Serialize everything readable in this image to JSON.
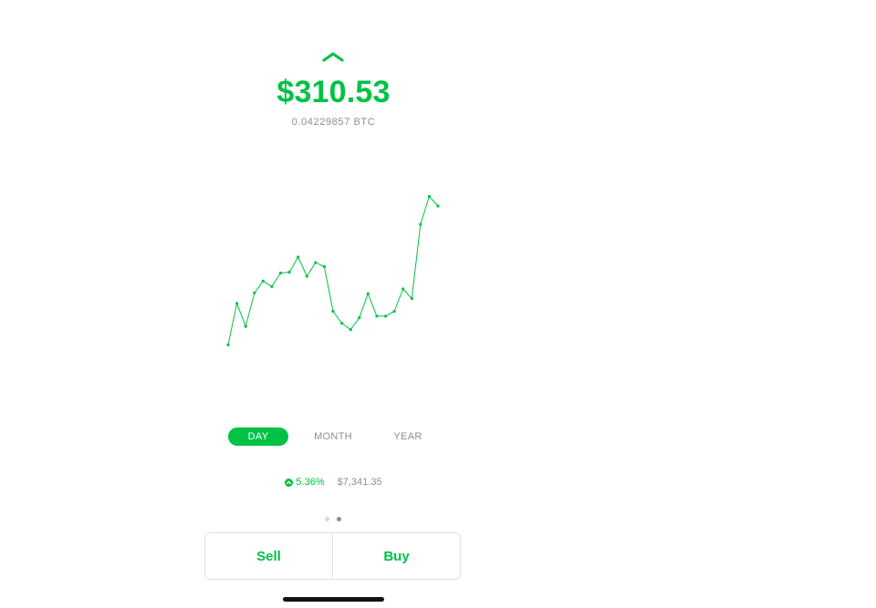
{
  "header": {
    "collapse_icon": "chevron-up-icon",
    "balance_usd": "$310.53",
    "balance_btc": "0.04229857 BTC"
  },
  "colors": {
    "accent": "#00c244",
    "muted_text": "#8e8e93",
    "border": "#e2e2e6"
  },
  "chart_data": {
    "type": "line",
    "title": "",
    "xlabel": "",
    "ylabel": "",
    "grid": false,
    "markers": true,
    "series": [
      {
        "values": [
          1.0,
          27.0,
          12.5,
          33.5,
          41.0,
          37.5,
          46.0,
          46.5,
          56.0,
          44.0,
          52.5,
          50.0,
          22.0,
          14.5,
          10.5,
          18.0,
          33.0,
          19.0,
          19.0,
          22.0,
          36.0,
          30.0,
          76.5,
          94.0,
          88.0
        ]
      }
    ]
  },
  "ranges": {
    "items": [
      {
        "label": "DAY",
        "active": true
      },
      {
        "label": "MONTH",
        "active": false
      },
      {
        "label": "YEAR",
        "active": false
      }
    ]
  },
  "stats": {
    "change_icon": "arrow-up-circle-icon",
    "change_percent": "5.36%",
    "btc_price": "$7,341.35"
  },
  "pager": {
    "count": 2,
    "active_index": 1
  },
  "actions": {
    "sell_label": "Sell",
    "buy_label": "Buy"
  }
}
